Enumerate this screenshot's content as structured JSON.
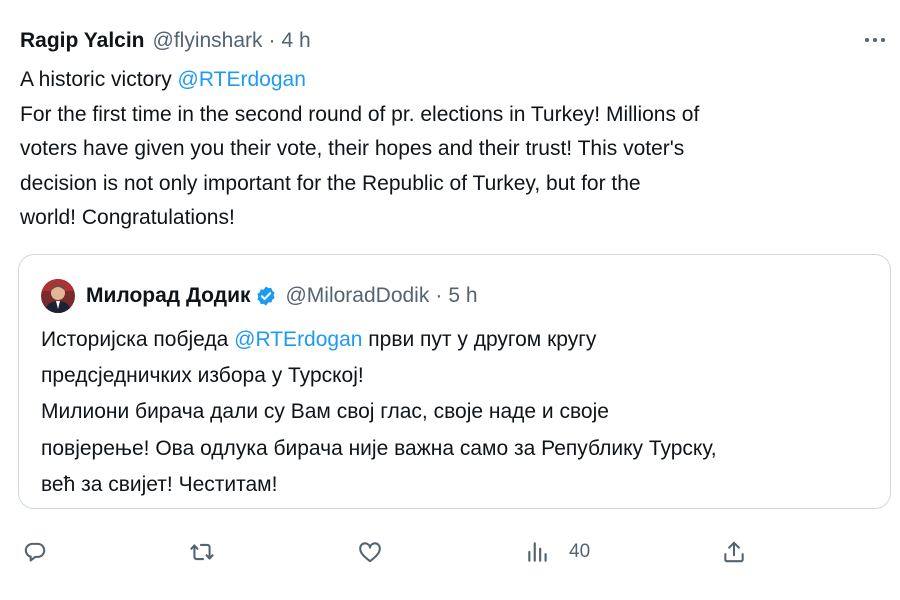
{
  "tweet": {
    "author_name": "Ragip Yalcin",
    "author_handle": "@flyinshark",
    "separator": "·",
    "time": "4 h",
    "text_line1_prefix": "A historic victory ",
    "text_line1_mention": "@RTErdogan",
    "text_lines": [
      "For the first time in the second round of pr. elections in Turkey!  Millions of",
      "voters have given you their vote, their hopes and their trust! This voter's",
      "decision is not only important for the Republic of Turkey, but for the",
      "world! Congratulations!"
    ]
  },
  "quote": {
    "author_name": "Милорад Додик",
    "author_handle": "@MiloradDodik",
    "separator": "·",
    "time": "5 h",
    "line1_prefix": "Историјска побједа  ",
    "line1_mention": "@RTErdogan",
    "line1_suffix": " први пут у другом кругу",
    "text_lines": [
      "предсједничких избора у Турској!",
      "Милиони бирача дали су Вам свој глас, своје наде и своје",
      "повјерење! Ова одлука бирача није важна само за Републику Турску,",
      "већ за свијет! Честитам!"
    ]
  },
  "actions": {
    "views_count": "40"
  },
  "icons": {
    "more": "more-horizontal-icon",
    "reply": "reply-icon",
    "retweet": "retweet-icon",
    "like": "heart-icon",
    "views": "views-bar-chart-icon",
    "share": "share-icon",
    "verified": "verified-badge-icon"
  },
  "colors": {
    "text": "#0f1419",
    "secondary": "#536471",
    "link": "#1d9bf0",
    "border": "#cfd9de"
  }
}
